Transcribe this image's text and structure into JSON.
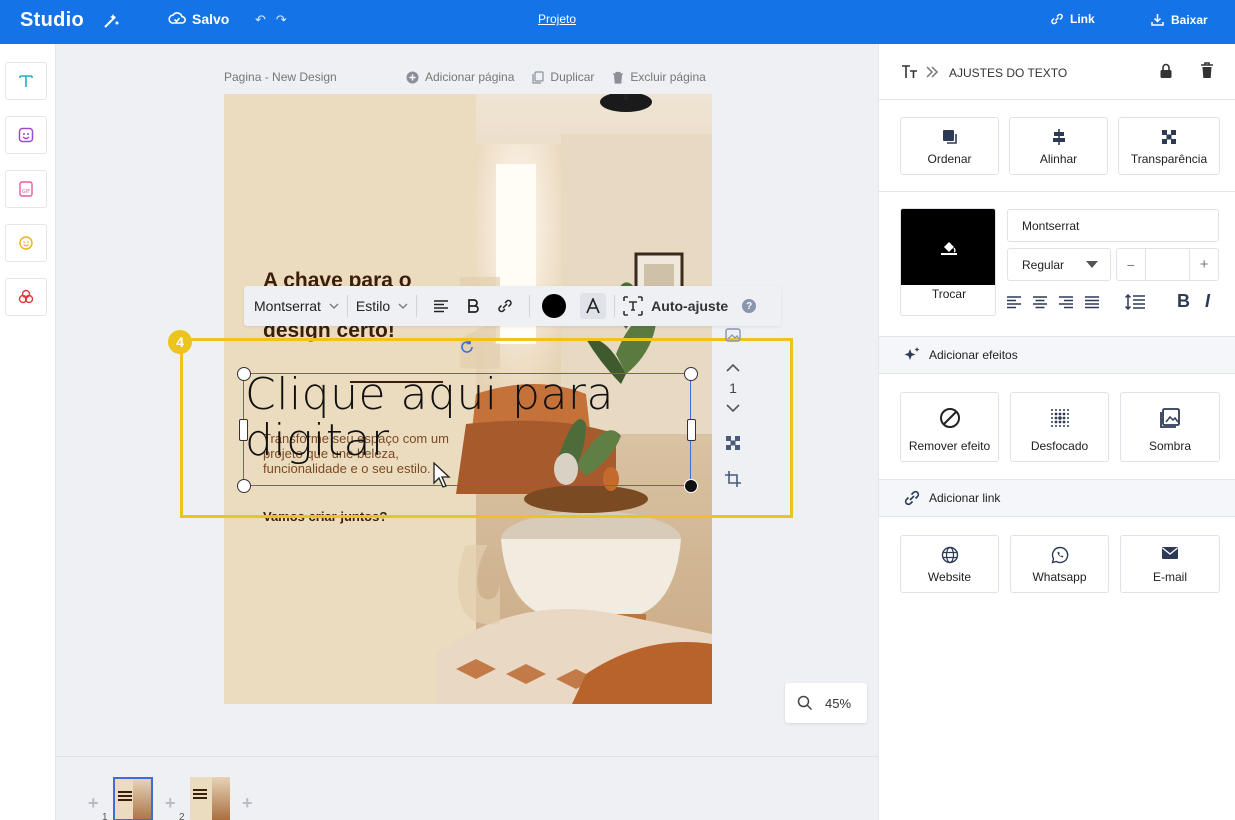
{
  "topbar": {
    "logo": "Studio",
    "saved": "Salvo",
    "project": "Projeto",
    "link": "Link",
    "download": "Baixar"
  },
  "canvas": {
    "page_name": "Pagina - New Design",
    "add_page": "Adicionar página",
    "duplicate": "Duplicar",
    "delete_page": "Excluir página",
    "headline": "A chave para o perfeito está no design certo!",
    "body": "Transforme seu espaço com um projeto que une beleza, funcionalidade e o seu estilo.",
    "cta": "Vamos criar juntos?",
    "selected_text": "Clique aqui para digitar",
    "layer_number": "1",
    "badge": "4",
    "zoom": "45%"
  },
  "toolbar": {
    "font": "Montserrat",
    "style": "Estilo",
    "auto_fit": "Auto-ajuste",
    "help": "?",
    "text_color": "#000000"
  },
  "pages": [
    {
      "number": "1",
      "active": true
    },
    {
      "number": "2",
      "active": false
    }
  ],
  "panel": {
    "title": "AJUSTES DO TEXTO",
    "arrange": [
      "Ordenar",
      "Alinhar",
      "Transparência"
    ],
    "swap": "Trocar",
    "font": "Montserrat",
    "weight": "Regular",
    "size_minus": "−",
    "size_plus": "+",
    "bold": "B",
    "italic": "I",
    "effects_header": "Adicionar efeitos",
    "effects": [
      "Remover efeito",
      "Desfocado",
      "Sombra"
    ],
    "link_header": "Adicionar link",
    "links": [
      "Website",
      "Whatsapp",
      "E-mail"
    ]
  },
  "colors": {
    "brand": "#1473e6",
    "highlight": "#ecc41b",
    "selection": "#3b6fd8",
    "headline": "#3a1d0a"
  }
}
